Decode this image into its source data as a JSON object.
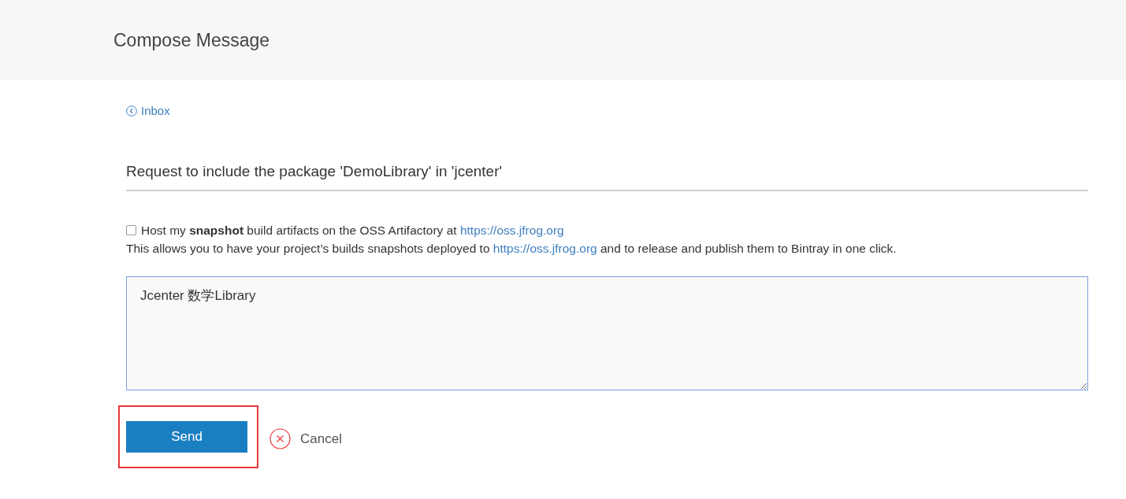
{
  "header": {
    "title": "Compose Message"
  },
  "back_link": {
    "label": "Inbox"
  },
  "subject": {
    "value": "Request to include the package 'DemoLibrary' in 'jcenter'"
  },
  "snapshot_option": {
    "checked": false,
    "label": "Host my **snapshot** build artifacts on the OSS Artifactory at",
    "link": "https://oss.jfrog.org"
  },
  "description": {
    "before": "This allows you to have your project’s builds snapshots deployed to",
    "link": "https://oss.jfrog.org",
    "after": "and to release and publish them to Bintray in one click."
  },
  "message": {
    "value": "Jcenter 数学Library"
  },
  "buttons": {
    "send": "Send",
    "cancel": "Cancel"
  }
}
